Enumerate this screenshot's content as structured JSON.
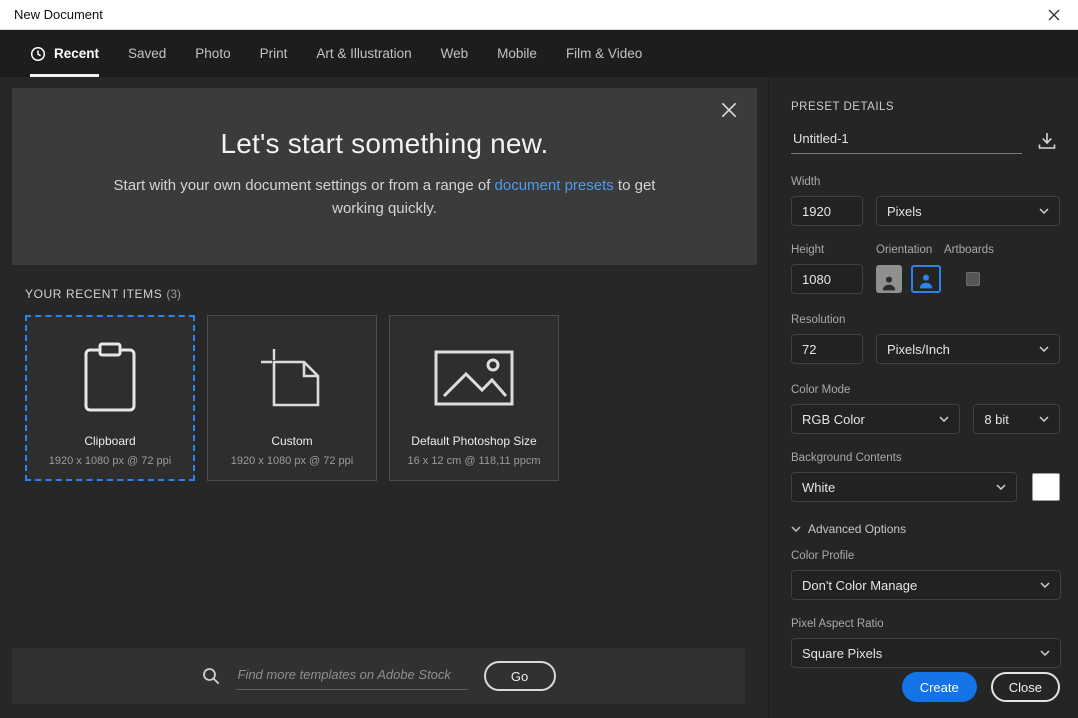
{
  "window": {
    "title": "New Document"
  },
  "tabs": [
    {
      "label": "Recent"
    },
    {
      "label": "Saved"
    },
    {
      "label": "Photo"
    },
    {
      "label": "Print"
    },
    {
      "label": "Art & Illustration"
    },
    {
      "label": "Web"
    },
    {
      "label": "Mobile"
    },
    {
      "label": "Film & Video"
    }
  ],
  "hero": {
    "title": "Let's start something new.",
    "text_before": "Start with your own document settings or from a range of ",
    "link_text": "document presets",
    "text_after": " to get working quickly."
  },
  "recent": {
    "heading": "YOUR RECENT ITEMS",
    "count": "(3)",
    "items": [
      {
        "name": "Clipboard",
        "spec": "1920 x 1080 px @ 72 ppi"
      },
      {
        "name": "Custom",
        "spec": "1920 x 1080 px @ 72 ppi"
      },
      {
        "name": "Default Photoshop Size",
        "spec": "16 x 12 cm @ 118,11 ppcm"
      }
    ]
  },
  "search": {
    "placeholder": "Find more templates on Adobe Stock",
    "go_label": "Go"
  },
  "preset": {
    "heading": "PRESET DETAILS",
    "name_value": "Untitled-1",
    "width_label": "Width",
    "width_value": "1920",
    "width_unit": "Pixels",
    "height_label": "Height",
    "height_value": "1080",
    "orientation_label": "Orientation",
    "artboards_label": "Artboards",
    "resolution_label": "Resolution",
    "resolution_value": "72",
    "resolution_unit": "Pixels/Inch",
    "color_mode_label": "Color Mode",
    "color_mode_value": "RGB Color",
    "bit_depth_value": "8 bit",
    "background_label": "Background Contents",
    "background_value": "White",
    "advanced_label": "Advanced Options",
    "color_profile_label": "Color Profile",
    "color_profile_value": "Don't Color Manage",
    "pixel_aspect_label": "Pixel Aspect Ratio",
    "pixel_aspect_value": "Square Pixels",
    "create_label": "Create",
    "close_label": "Close"
  },
  "colors": {
    "accent": "#1473e6",
    "link": "#4e9bef",
    "selection": "#2b83ee"
  }
}
